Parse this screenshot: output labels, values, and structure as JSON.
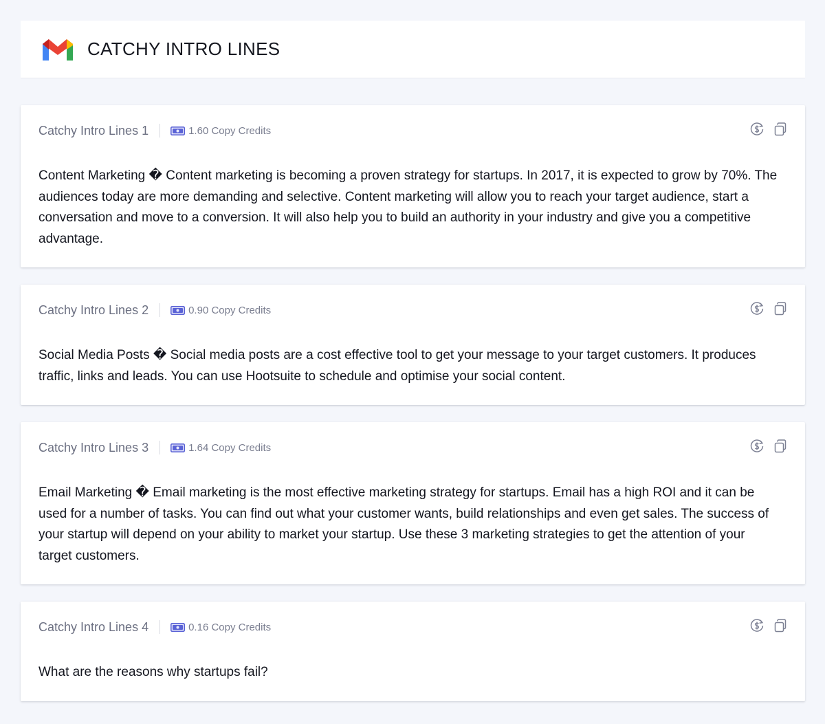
{
  "header": {
    "title": "CATCHY INTRO LINES",
    "logo_icon": "gmail-logo-icon",
    "colors": {
      "red": "#EA4335",
      "blue": "#4285F4",
      "green": "#34A853",
      "yellow": "#FBBC04"
    }
  },
  "cards": [
    {
      "title": "Catchy Intro Lines 1",
      "credits": "1.60 Copy Credits",
      "text": "Content Marketing � Content marketing is becoming a proven strategy for startups. In 2017, it is expected to grow by 70%. The audiences today are more demanding and selective. Content marketing will allow you to reach your target audience, start a conversation and move to a conversion. It will also help you to build an authority in your industry and give you a competitive advantage."
    },
    {
      "title": "Catchy Intro Lines 2",
      "credits": "0.90 Copy Credits",
      "text": "Social Media Posts � Social media posts are a cost effective tool to get your message to your target customers. It produces traffic, links and leads. You can use Hootsuite to schedule and optimise your social content."
    },
    {
      "title": "Catchy Intro Lines 3",
      "credits": "1.64 Copy Credits",
      "text": "Email Marketing � Email marketing is the most effective marketing strategy for startups. Email has a high ROI and it can be used for a number of tasks. You can find out what your customer wants, build relationships and even get sales. The success of your startup will depend on your ability to market your startup. Use these 3 marketing strategies to get the attention of your target customers."
    },
    {
      "title": "Catchy Intro Lines 4",
      "credits": "0.16 Copy Credits",
      "text": "What are the reasons why startups fail?"
    }
  ],
  "icons": {
    "credit": "money-bill-icon",
    "regenerate": "dollar-refresh-icon",
    "copy": "copy-icon"
  },
  "colors": {
    "page_background": "#f4f6fb",
    "card_background": "#ffffff",
    "credit_icon": "#5b63d6",
    "action_icon": "#7d8194",
    "muted_text": "#6c7082"
  }
}
